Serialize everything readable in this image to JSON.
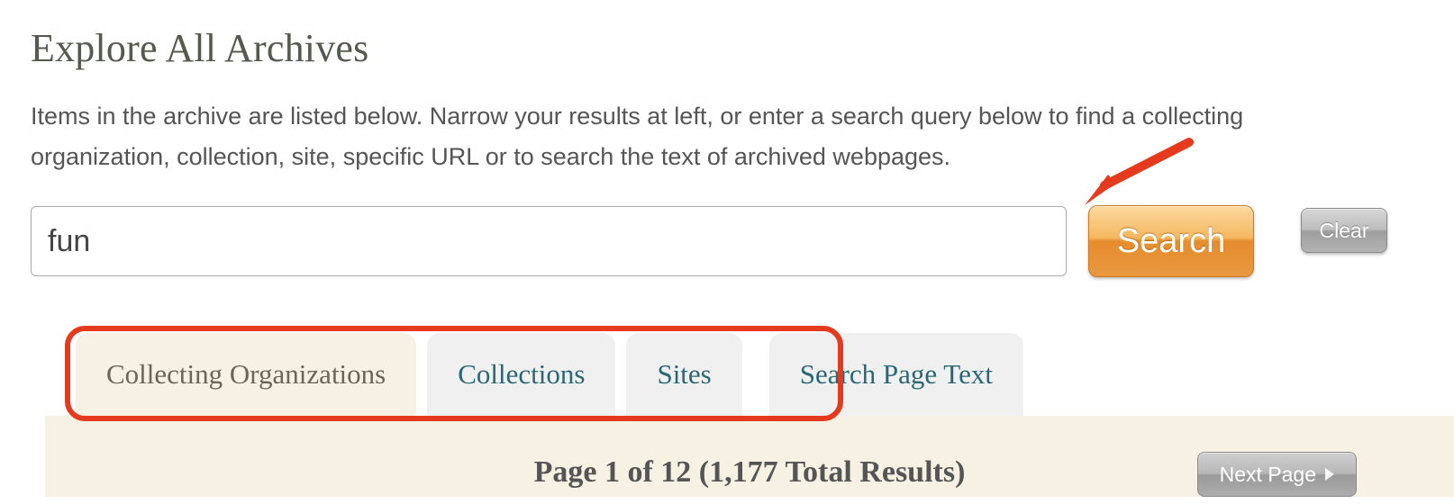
{
  "page": {
    "title": "Explore All Archives",
    "intro": "Items in the archive are listed below. Narrow your results at left, or enter a search query below to find a collecting organization, collection, site, specific URL or to search the text of archived webpages."
  },
  "search": {
    "value": "fun",
    "placeholder": "",
    "search_label": "Search",
    "clear_label": "Clear"
  },
  "tabs": [
    {
      "label": "Collecting Organizations",
      "active": true
    },
    {
      "label": "Collections",
      "active": false
    },
    {
      "label": "Sites",
      "active": false
    },
    {
      "label": "Search Page Text",
      "active": false
    }
  ],
  "results": {
    "summary": "Page 1 of 12 (1,177 Total Results)",
    "next_label": "Next Page"
  },
  "annotations": {
    "highlight_tabs": true,
    "arrow_to_search": true
  },
  "colors": {
    "heading": "#555a4e",
    "tab_link": "#2a6775",
    "tab_active_bg": "#f6f1e3",
    "tab_bg": "#f0f0f0",
    "annotation_red": "#e63a1f",
    "search_btn_orange": "#e9983f"
  }
}
